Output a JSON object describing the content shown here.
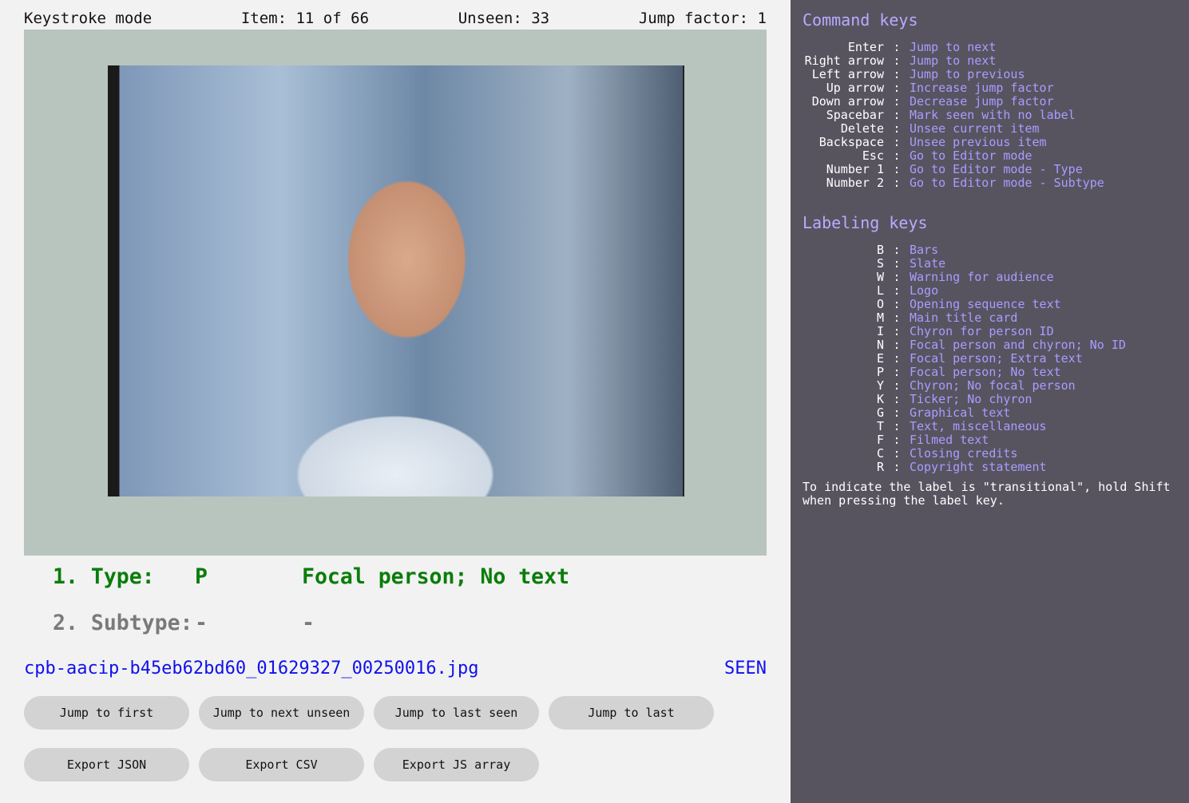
{
  "header": {
    "mode": "Keystroke mode",
    "item": "Item: 11 of 66",
    "unseen": "Unseen: 33",
    "jump_factor": "Jump factor: 1"
  },
  "annotations": [
    {
      "label": "1. Type:",
      "code": "P",
      "value": "Focal person; No text"
    },
    {
      "label": "2. Subtype:",
      "code": "-",
      "value": "-"
    }
  ],
  "file": {
    "name": "cpb-aacip-b45eb62bd60_01629327_00250016.jpg",
    "status": "SEEN"
  },
  "buttons": [
    "Jump to first",
    "Jump to next unseen",
    "Jump to last seen",
    "Jump to last",
    "Export JSON",
    "Export CSV",
    "Export JS array"
  ],
  "sidebar": {
    "command_title": "Command keys",
    "commands": [
      [
        "Enter",
        "Jump to next"
      ],
      [
        "Right arrow",
        "Jump to next"
      ],
      [
        "Left arrow",
        "Jump to previous"
      ],
      [
        "Up arrow",
        "Increase jump factor"
      ],
      [
        "Down arrow",
        "Decrease jump factor"
      ],
      [
        "Spacebar",
        "Mark seen with no label"
      ],
      [
        "Delete",
        "Unsee current item"
      ],
      [
        "Backspace",
        "Unsee previous item"
      ],
      [
        "Esc",
        "Go to Editor mode"
      ],
      [
        "Number 1",
        "Go to Editor mode - Type"
      ],
      [
        "Number 2",
        "Go to Editor mode - Subtype"
      ]
    ],
    "labeling_title": "Labeling keys",
    "labels": [
      [
        "B",
        "Bars"
      ],
      [
        "S",
        "Slate"
      ],
      [
        "W",
        "Warning for audience"
      ],
      [
        "L",
        "Logo"
      ],
      [
        "O",
        "Opening sequence text"
      ],
      [
        "M",
        "Main title card"
      ],
      [
        "I",
        "Chyron for person ID"
      ],
      [
        "N",
        "Focal person and chyron; No ID"
      ],
      [
        "E",
        "Focal person; Extra text"
      ],
      [
        "P",
        "Focal person; No text"
      ],
      [
        "Y",
        "Chyron; No focal person"
      ],
      [
        "K",
        "Ticker; No chyron"
      ],
      [
        "G",
        "Graphical text"
      ],
      [
        "T",
        "Text, miscellaneous"
      ],
      [
        "F",
        "Filmed text"
      ],
      [
        "C",
        "Closing credits"
      ],
      [
        "R",
        "Copyright statement"
      ]
    ],
    "note": "To indicate the label is \"transitional\", hold Shift when pressing the label key."
  },
  "colors": {
    "frame": "#b8c5be",
    "sidebar": "#575460",
    "accent_green": "#0a7d0a",
    "link_blue": "#1010ee",
    "key_desc": "#a99dff"
  }
}
